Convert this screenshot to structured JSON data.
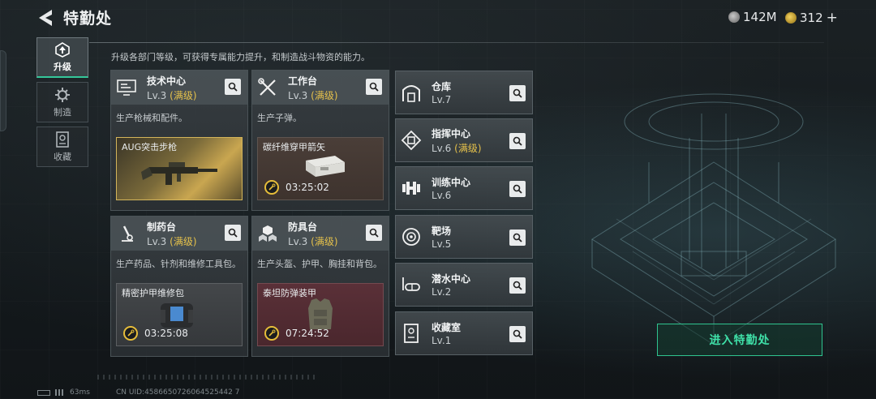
{
  "header": {
    "title": "特勤处",
    "currency1": "142M",
    "currency2": "312",
    "plus": "+"
  },
  "side_nav": [
    {
      "label": "升级",
      "icon": "upgrade-icon",
      "active": true
    },
    {
      "label": "制造",
      "icon": "gear-icon",
      "active": false
    },
    {
      "label": "收藏",
      "icon": "collection-icon",
      "active": false
    }
  ],
  "description": "升级各部门等级，可获得专属能力提升，和制造战斗物资的能力。",
  "stations": [
    {
      "name": "技术中心",
      "level": "Lv.3",
      "maxed": "(满级)",
      "desc": "生产枪械和配件。",
      "item": "AUG突击步枪",
      "timer": "",
      "icon": "tech-center-icon"
    },
    {
      "name": "工作台",
      "level": "Lv.3",
      "maxed": "(满级)",
      "desc": "生产子弹。",
      "item": "碳纤维穿甲箭矢",
      "timer": "03:25:02",
      "icon": "workbench-icon"
    },
    {
      "name": "制药台",
      "level": "Lv.3",
      "maxed": "(满级)",
      "desc": "生产药品、针剂和维修工具包。",
      "item": "精密护甲维修包",
      "timer": "03:25:08",
      "icon": "pharmacy-icon"
    },
    {
      "name": "防具台",
      "level": "Lv.3",
      "maxed": "(满级)",
      "desc": "生产头盔、护甲、胸挂和背包。",
      "item": "泰坦防弹装甲",
      "timer": "07:24:52",
      "icon": "armor-bench-icon"
    }
  ],
  "facilities": [
    {
      "name": "仓库",
      "level": "Lv.7",
      "maxed": "",
      "icon": "warehouse-icon"
    },
    {
      "name": "指挥中心",
      "level": "Lv.6",
      "maxed": "(满级)",
      "icon": "command-center-icon"
    },
    {
      "name": "训练中心",
      "level": "Lv.6",
      "maxed": "",
      "icon": "training-center-icon"
    },
    {
      "name": "靶场",
      "level": "Lv.5",
      "maxed": "",
      "icon": "shooting-range-icon"
    },
    {
      "name": "潜水中心",
      "level": "Lv.2",
      "maxed": "",
      "icon": "diving-center-icon"
    },
    {
      "name": "收藏室",
      "level": "Lv.1",
      "maxed": "",
      "icon": "collection-room-icon"
    }
  ],
  "enter_button": "进入特勤处",
  "footer": {
    "ping": "63ms",
    "uid": "CN UID:4586650726064525442 7"
  },
  "colors": {
    "accent": "#34c79a",
    "maxed": "#e5c14b"
  }
}
